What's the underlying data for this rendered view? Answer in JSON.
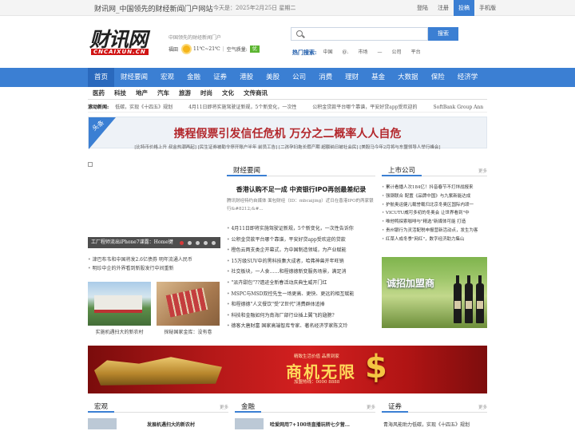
{
  "topbar": {
    "site_name": "财讯网_中国领先的财经新闻门户网站",
    "date": "今天是：2025年2月25日 星期二",
    "links": [
      "登陆",
      "注册",
      "投稿",
      "手机版"
    ]
  },
  "logo": {
    "cn": "财讯网",
    "en": "CNCAIXUN.CN"
  },
  "slogan": "中国领先的财经新闻门户",
  "weather": {
    "city": "福田",
    "temp": "11℃~21℃",
    "aq_label": "空气质量:",
    "aq_value": "优"
  },
  "search": {
    "placeholder": "",
    "button": "搜索"
  },
  "hot": {
    "label": "热门搜索:",
    "terms": [
      "中国",
      "@.",
      "市场",
      "—",
      "公司",
      "平台"
    ]
  },
  "nav": {
    "items": [
      "首页",
      "财经要闻",
      "宏观",
      "金融",
      "证券",
      "港股",
      "美股",
      "公司",
      "消费",
      "理财",
      "基金",
      "大数据",
      "保险",
      "经济学"
    ]
  },
  "subnav": {
    "items": [
      "医药",
      "科技",
      "地产",
      "汽车",
      "旅游",
      "时尚",
      "文化",
      "文传商讯"
    ]
  },
  "ticker": {
    "label": "滚动新闻:",
    "items": [
      "低碳，实现《十四五》规划",
      "4月11日即将实施驾驶证新规，5个新变化，一次性",
      "公积金贷款平台哪个靠谱，平安好贷app受欢迎的",
      "SoftBank Group Ann"
    ]
  },
  "headline": {
    "tag": "头条",
    "title": "携程假票引发信任危机 万分之二概率人人自危",
    "sublinks": "[比特币价格上升 叔金热潮再起] [民生证券被勒令停开账户半年 前员工告] [二孩孕妇拖长假产期 超额纳日被社会民] [美股马今年2月将与东盟领导人举行峰会]"
  },
  "slider": {
    "caption": "工厂程师流出iPhone7谍露：Home键",
    "dots": 5
  },
  "left_list": [
    "津巴布韦和中国将发2.6亿债券 明年流通人民币",
    "明珍中企的外界看到新股发行中间重新"
  ],
  "thumbs": [
    {
      "caption": "实施机遇扫大的新农村"
    },
    {
      "caption": "探秘国家金库：没有卷"
    }
  ],
  "caijing": {
    "section": "财经要闻",
    "more": "更多",
    "title": "香港认购不足一成 中资银行IPO再创最差纪录",
    "summary": "腾讯财经特约自媒体 面包财经（ID：mbcaijing）近日在香港IPO的两家银行&#8212;&#...",
    "list": [
      "4月11日即将实施驾驶证新规，5个新变化，一次性告诉你",
      "公积金贷款平台哪个靠谱，平安好贷app受欢迎的贷款",
      "橙色云两支类企开幕式，为中国制造领域，为产业赋能",
      "15万级SUV中的黑科技集大成者，哈弗神兽开年旺销",
      "社交板块，一人食……和程德德新变服务场景，满足消",
      "\"派卉甜包\"??遗迹全新春活动庆典生威开门红",
      "MSPC与MSD双控先生一场更高、更快、更远的相互赋能",
      "和程德德\"人文餐饮\"受\"Z世代\"消费群体追捧",
      "科技和金融如何为南海厂部行业插上翼飞的翅膀?",
      "德客大唐财富 国家高端智库专家、著名经济学家陈文玲"
    ]
  },
  "company": {
    "section": "上市公司",
    "more": "更多",
    "list": [
      "累计看播人次184亿！抖音春节不打烊战报来",
      "强钢联合 配置《品牌中国》与九紫新能达成",
      "护航奥运健儿载誉载归北京冬奥区国际内颂一",
      "VICUTU威可多初的冬奥会 让世界看到\"中",
      "唯他鸭探索咖啡与\"精选\"新媒体可能 打造",
      "贵州银行为灵活配税申报营新活动点，发生为客",
      "红菜人成冬季\"网红\"，数字经济助力集山"
    ],
    "ad": "诚招加盟商"
  },
  "banner": {
    "small": "精致生活价值 品质到家",
    "big": "商机无限",
    "tel": "加盟热线：0000 8888"
  },
  "bottom": [
    {
      "section": "宏观",
      "more": "更多",
      "item": "发展机遇扫大的新农村"
    },
    {
      "section": "金融",
      "more": "更多",
      "item": "哈爱网用7+100场直播玩转七夕营..."
    },
    {
      "section": "证券",
      "more": "更多",
      "item": "青海风能助力低碳，实现《十四五》规划"
    }
  ],
  "colors": {
    "brand_blue": "#3b7fd3",
    "headline_red": "#b3282d",
    "banner_red": "#c41a1a"
  }
}
